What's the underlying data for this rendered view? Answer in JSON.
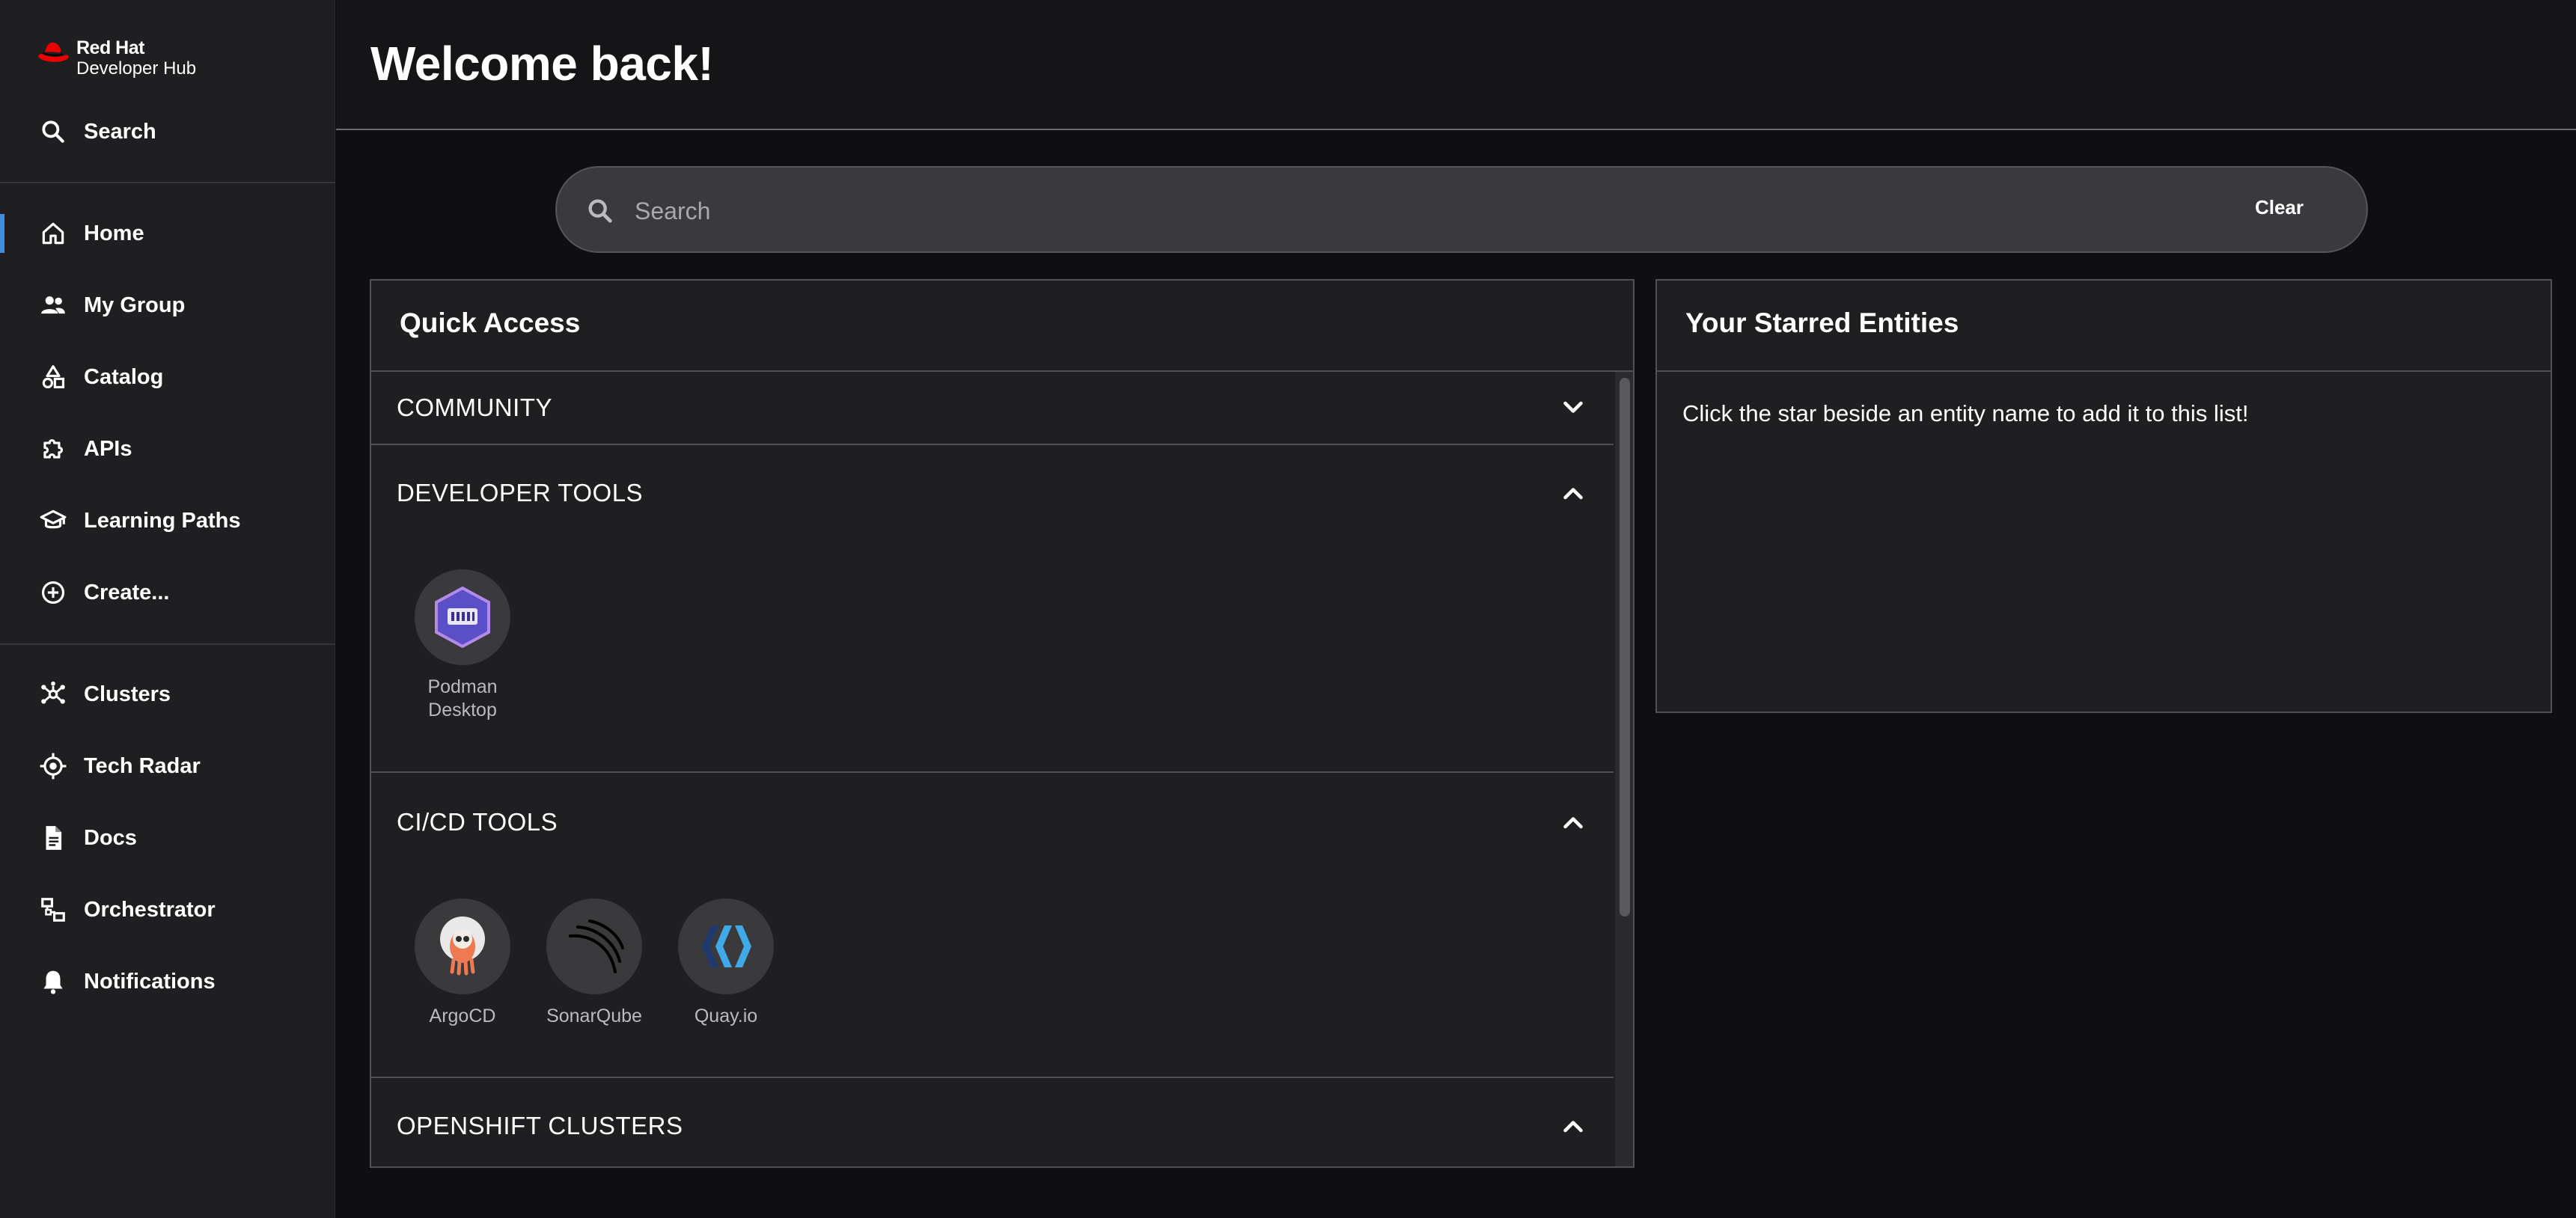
{
  "brand": {
    "line1": "Red Hat",
    "line2": "Developer Hub",
    "color": "#ee0000"
  },
  "sidebar": {
    "search_label": "Search",
    "items": [
      {
        "label": "Home",
        "icon": "home-icon",
        "active": true
      },
      {
        "label": "My Group",
        "icon": "group-icon"
      },
      {
        "label": "Catalog",
        "icon": "catalog-icon"
      },
      {
        "label": "APIs",
        "icon": "puzzle-icon"
      },
      {
        "label": "Learning Paths",
        "icon": "school-icon"
      },
      {
        "label": "Create...",
        "icon": "add-circle-icon"
      }
    ],
    "plugins": [
      {
        "label": "Clusters",
        "icon": "clusters-icon"
      },
      {
        "label": "Tech Radar",
        "icon": "radar-icon"
      },
      {
        "label": "Docs",
        "icon": "document-icon"
      },
      {
        "label": "Orchestrator",
        "icon": "workflow-icon"
      },
      {
        "label": "Notifications",
        "icon": "bell-icon"
      }
    ],
    "accent": "#3e8ede"
  },
  "header": {
    "title": "Welcome back!"
  },
  "search": {
    "placeholder": "Search",
    "value": "",
    "clear_label": "Clear"
  },
  "quick_access": {
    "title": "Quick Access",
    "sections": [
      {
        "title": "COMMUNITY",
        "expanded": false,
        "tiles": []
      },
      {
        "title": "DEVELOPER TOOLS",
        "expanded": true,
        "tiles": [
          {
            "label": "Podman Desktop",
            "icon": "podman-icon"
          }
        ]
      },
      {
        "title": "CI/CD TOOLS",
        "expanded": true,
        "tiles": [
          {
            "label": "ArgoCD",
            "icon": "argocd-icon"
          },
          {
            "label": "SonarQube",
            "icon": "sonarqube-icon"
          },
          {
            "label": "Quay.io",
            "icon": "quay-icon"
          }
        ]
      },
      {
        "title": "OPENSHIFT CLUSTERS",
        "expanded": true,
        "tiles": []
      }
    ]
  },
  "starred": {
    "title": "Your Starred Entities",
    "empty_message": "Click the star beside an entity name to add it to this list!"
  }
}
